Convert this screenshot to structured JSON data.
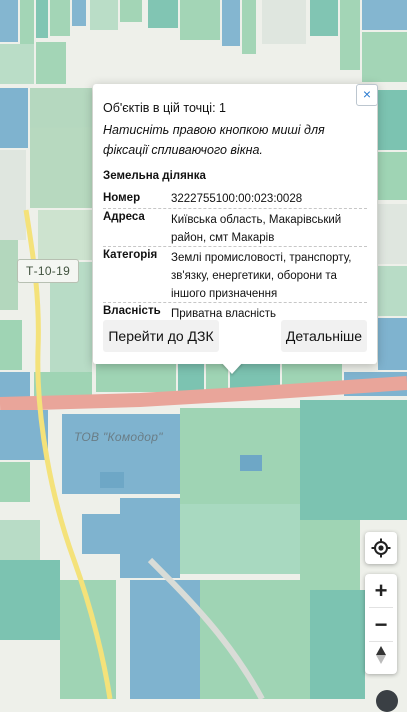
{
  "map": {
    "road_label": "Т-10-19",
    "poi_label": "ТОВ \"Комодор\""
  },
  "popup": {
    "objects_line": "Об'єктів в цій точці: 1",
    "hint": "Натисніть правою кнопкою миші для фіксації спливаючого вікна.",
    "close_label": "×",
    "section_title": "Земельна ділянка",
    "rows": [
      {
        "key": "Номер",
        "value": "3222755100:00:023:0028"
      },
      {
        "key": "Адреса",
        "value": "Київська область, Макарівський район, смт Макарів"
      },
      {
        "key": "Категорія",
        "value": "Землі промисловості, транспорту, зв'язку, енергетики, оборони та іншого призначення"
      },
      {
        "key": "Власність",
        "value": "Приватна власність"
      }
    ],
    "btn_dzk": "Перейти до ДЗК",
    "btn_more": "Детальніше"
  },
  "controls": {
    "locate_icon": "crosshair-icon",
    "zoom_in_label": "+",
    "zoom_out_label": "−",
    "compass_icon": "compass-icon"
  },
  "colors": {
    "parcel_green": "#9fd4b4",
    "parcel_teal": "#7cc3b1",
    "parcel_blue": "#7fb3cf",
    "main_road": "#e9a59a",
    "secondary_road": "#f4e27a",
    "accent_link": "#2b7bd0"
  }
}
